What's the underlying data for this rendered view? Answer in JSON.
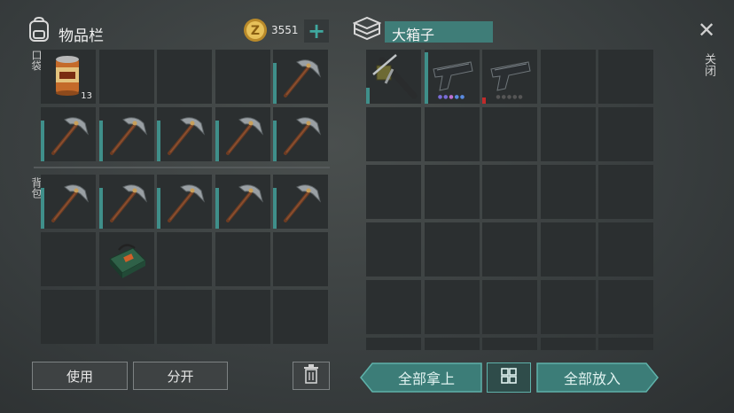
{
  "inventory": {
    "title": "物品栏",
    "pocket_label": "口袋",
    "backpack_label": "背包"
  },
  "currency": {
    "amount": "3551",
    "plus": "+"
  },
  "container": {
    "title": "大箱子"
  },
  "close": {
    "label": "关闭",
    "symbol": "✕"
  },
  "pocket_slots": [
    "canned-food",
    "",
    "",
    "",
    "pickaxe",
    "pickaxe",
    "pickaxe",
    "pickaxe",
    "pickaxe",
    "pickaxe"
  ],
  "can_quantity": "13",
  "backpack_slots": [
    "pickaxe",
    "pickaxe",
    "pickaxe",
    "pickaxe",
    "pickaxe",
    "",
    "medkit-bag",
    "",
    "",
    "",
    "",
    "",
    "",
    "",
    ""
  ],
  "container_slots": [
    "crossbow",
    "pistol",
    "pistol"
  ],
  "actions": {
    "use": "使用",
    "split": "分开",
    "take_all": "全部拿上",
    "put_all": "全部放入"
  },
  "colors": {
    "accent": "#3f8f8a",
    "slot": "#2b2f30",
    "gold": "#d4a63a"
  },
  "icons": [
    "backpack-icon",
    "coin-icon",
    "plus-icon",
    "box-stack-icon",
    "close-icon",
    "trash-icon",
    "sort-grid-icon",
    "pickaxe-icon",
    "canned-food-icon",
    "crossbow-icon",
    "pistol-icon",
    "medkit-bag-icon"
  ]
}
